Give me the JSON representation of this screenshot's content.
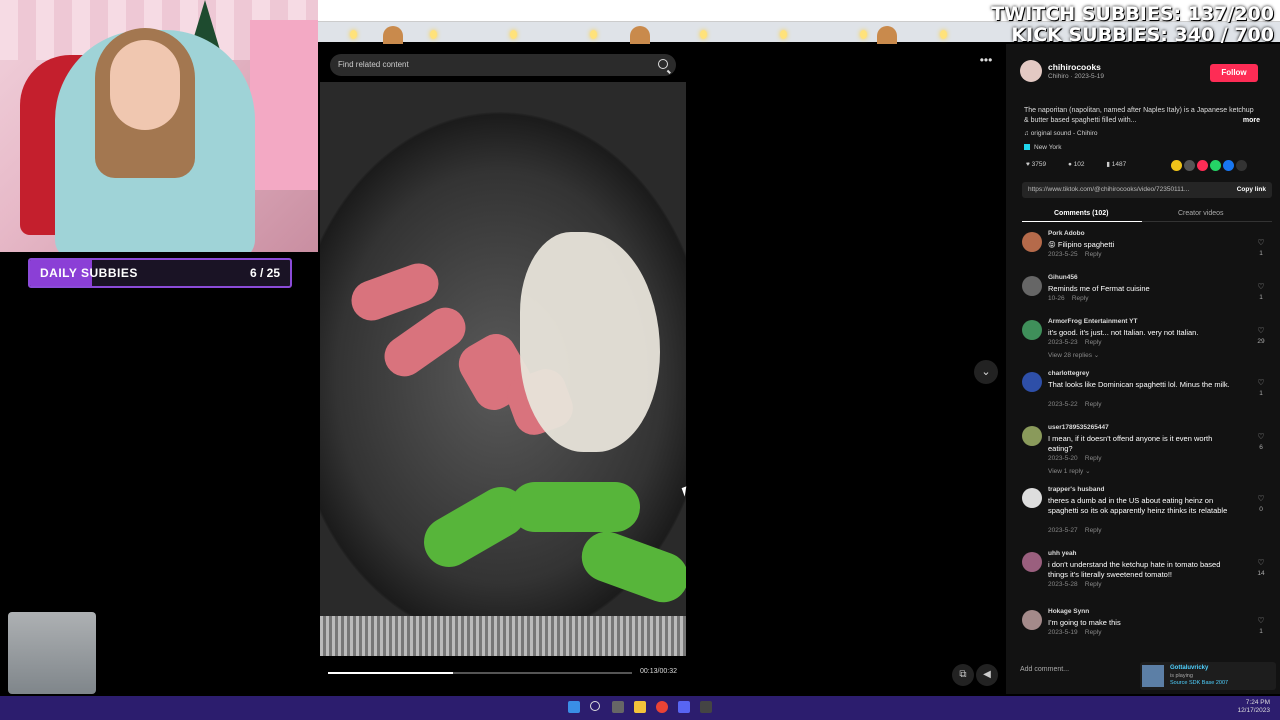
{
  "overlay": {
    "daily_subbies_label": "DAILY SUBBIES",
    "daily_subbies_count": "6 / 25",
    "daily_subbies_progress": 0.24,
    "twitch_subbies": "TWITCH SUBBIES: 137/200",
    "kick_subbies": "KICK SUBBIES: 340 / 700"
  },
  "tiktok": {
    "search_placeholder": "Find related content",
    "video_time": "00:13/00:32",
    "video_progress": 0.41,
    "author": {
      "handle": "chihirocooks",
      "subline": "Chihiro · 2023-5-19",
      "follow_label": "Follow"
    },
    "description": "The naporitan (napolitan, named after Naples Italy) is a Japanese ketchup & butter based spaghetti filled with...",
    "more_label": "more",
    "sound": "original sound - Chihiro",
    "location": "New York",
    "counts": {
      "likes": "3759",
      "comments": "102",
      "saves": "1487"
    },
    "link": "https://www.tiktok.com/@chihirocooks/video/72350111...",
    "copy_label": "Copy link",
    "tabs": [
      {
        "label": "Comments (102)"
      },
      {
        "label": "Creator videos"
      }
    ],
    "comments": [
      {
        "user": "Pork Adobo",
        "text": "😝 Filipino spaghetti",
        "date": "2023-5-25",
        "reply": "Reply",
        "likes": "1",
        "color": "#b56a4a"
      },
      {
        "user": "Gihun456",
        "text": "Reminds me of Fermat cuisine",
        "date": "10-26",
        "reply": "Reply",
        "likes": "1",
        "color": "#666666"
      },
      {
        "user": "ArmorFrog Entertainment YT",
        "text": "it's good. it's just... not Italian. very not Italian.",
        "date": "2023-5-23",
        "reply": "Reply",
        "likes": "29",
        "view_replies": "View 28 replies",
        "color": "#3f8f5a"
      },
      {
        "user": "charlottegrey",
        "text": "That looks like Dominican spaghetti lol. Minus the milk.",
        "date": "2023-5-22",
        "reply": "Reply",
        "likes": "1",
        "color": "#2e4fa8"
      },
      {
        "user": "user1789535265447",
        "text": "I mean, if it doesn't offend anyone is it even worth eating?",
        "date": "2023-5-20",
        "reply": "Reply",
        "likes": "6",
        "view_replies": "View 1 reply",
        "color": "#8a9a5b"
      },
      {
        "user": "trapper's husband",
        "text": "theres a dumb ad in the US about eating heinz on spaghetti so its ok apparently heinz thinks its relatable",
        "date": "2023-5-27",
        "reply": "Reply",
        "likes": "0",
        "color": "#dddddd"
      },
      {
        "user": "uhh yeah",
        "text": "i don't understand the ketchup hate in tomato based things it's literally sweetened tomato!!",
        "date": "2023-5-28",
        "reply": "Reply",
        "likes": "14",
        "color": "#9a5f7e"
      },
      {
        "user": "Hokage Synn",
        "text": "I'm going to make this",
        "date": "2023-5-19",
        "reply": "Reply",
        "likes": "1",
        "color": "#a48a8a"
      }
    ],
    "add_comment_placeholder": "Add comment..."
  },
  "notification": {
    "name": "Gottaluvricky",
    "status": "is playing",
    "game": "Source SDK Base 2007"
  },
  "taskbar": {
    "time": "7:24 PM",
    "date": "12/17/2023"
  }
}
